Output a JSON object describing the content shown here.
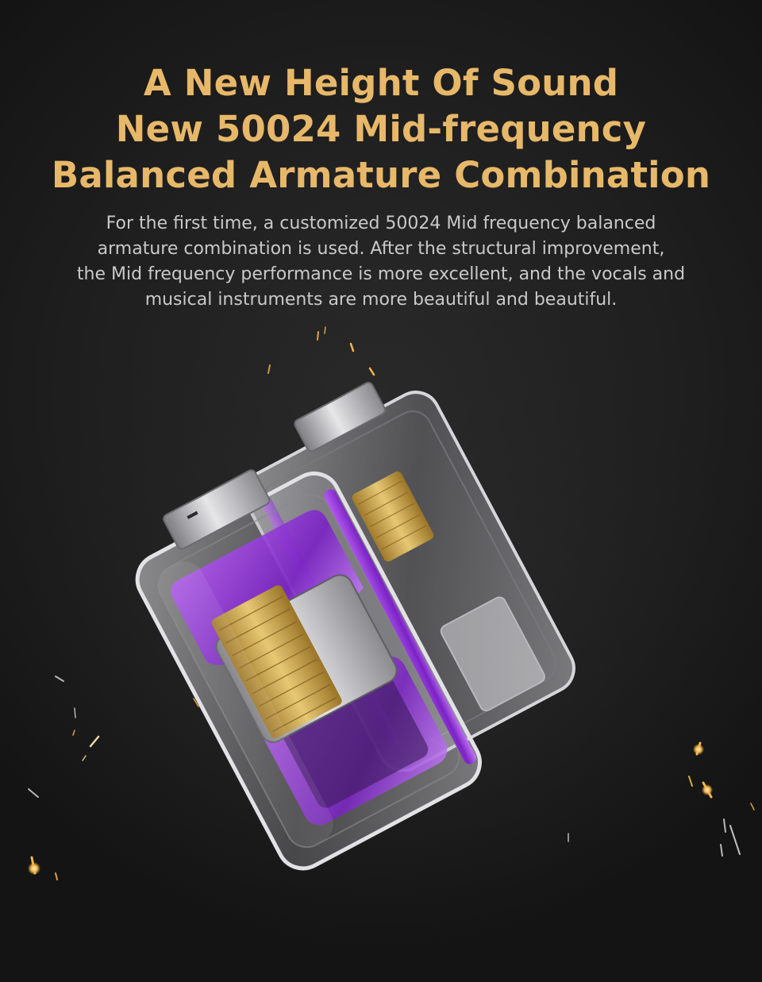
{
  "headline": {
    "lines": [
      "A New Height Of Sound",
      "New 50024 Mid-frequency",
      "Balanced Armature Combination"
    ]
  },
  "description": {
    "lines": [
      "For the first time, a customized 50024 Mid frequency balanced",
      "armature combination is used. After the structural improvement,",
      "the Mid frequency performance is more excellent, and the vocals and",
      "musical instruments are more beautiful and beautiful."
    ]
  },
  "colors": {
    "background": "#1c1c1c",
    "headline": "#e7b869",
    "body_text": "#c9c9c9",
    "accent_purple": "#9a3ee0",
    "coil_gold": "#c9a24a",
    "spark": "#f2b54a"
  }
}
